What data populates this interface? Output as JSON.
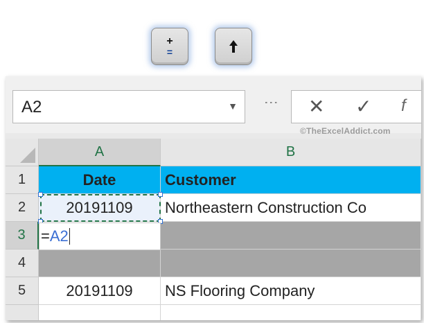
{
  "keys": {
    "plus_equals": {
      "top": "+",
      "bottom": "="
    },
    "shift": {
      "glyph": "🠅"
    }
  },
  "formula_bar": {
    "name_box": "A2",
    "cancel_icon": "✕",
    "enter_icon": "✓",
    "fx_partial": "f",
    "watermark": "©TheExcelAddict.com"
  },
  "columns": [
    "A",
    "B"
  ],
  "rows": [
    "1",
    "2",
    "3",
    "4",
    "5"
  ],
  "cells": {
    "A1": "Date",
    "B1": "Customer",
    "A2": "20191109",
    "B2": "Northeastern Construction Co",
    "A3_formula_eq": "=",
    "A3_formula_ref": "A2",
    "A5": "20191109",
    "B5": "NS Flooring Company"
  },
  "colors": {
    "header_fill": "#00b0f0",
    "gray_fill": "#a6a6a6",
    "excel_green": "#217346",
    "ref_blue": "#3b6fd4"
  }
}
